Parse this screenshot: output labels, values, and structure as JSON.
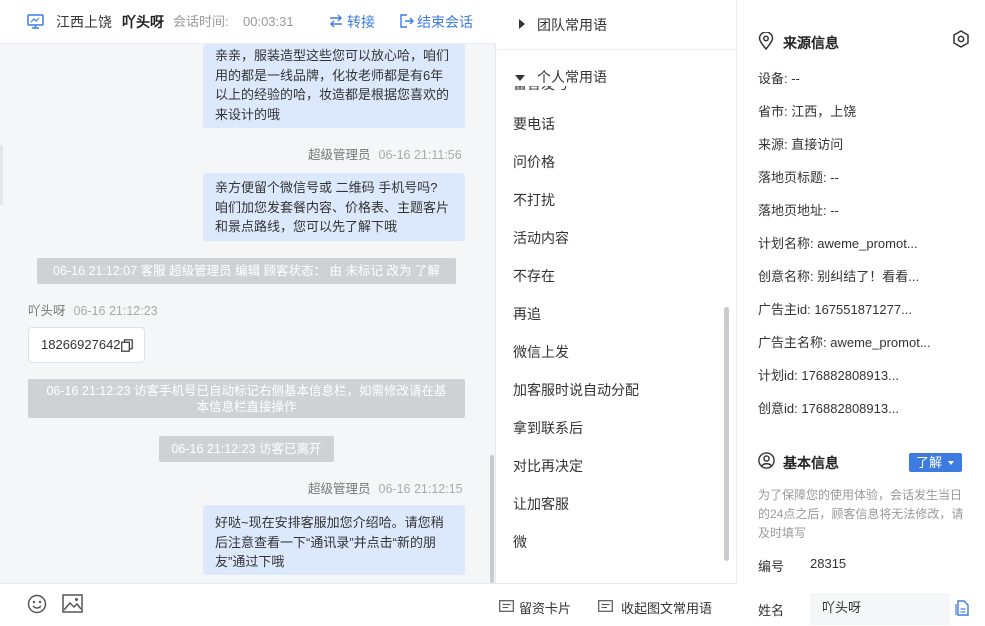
{
  "colors": {
    "accent": "#3d7be0",
    "bubble": "#dce9fd",
    "system_note": "#cfd1d5"
  },
  "header": {
    "region": "江西上饶",
    "visitor_name": "吖头呀",
    "time_label": "会话时间:",
    "time_value": "00:03:31",
    "transfer_label": "转接",
    "end_label": "结束会话"
  },
  "messages": {
    "bubble1": [
      "亲亲，服装造型这些您可以放心哈，咱们",
      "用的都是一线品牌，化妆老师都是有6年",
      "以上的经验的哈，妆造都是根据您喜欢的",
      "来设计的哦"
    ],
    "meta2": {
      "sender": "超级管理员",
      "time": "06-16 21:11:56"
    },
    "bubble2": [
      "亲方便留个微信号或 二维码 手机号吗?",
      "咱们加您发套餐内容、价格表、主题客片",
      "和景点路线，您可以先了解下哦"
    ],
    "sys1": "06-16 21:12:07 客服 超级管理员 编辑 顾客状态： 由 未标记 改为 了解",
    "meta3": {
      "sender": "吖头呀",
      "time": "06-16 21:12:23"
    },
    "phone": "18266927642",
    "sys2": [
      "06-16 21:12:23 访客手机号已自动标记右侧基本信息栏，如需修改请在基",
      "本信息栏直接操作"
    ],
    "sys3": "06-16 21:12:23 访客已离开",
    "meta4": {
      "sender": "超级管理员",
      "time": "06-16 21:12:15"
    },
    "bubble3": [
      "好哒~现在安排客服加您介绍哈。请您稍",
      "后注意查看一下“通讯录”并点击“新的朋",
      "友”通过下哦"
    ]
  },
  "footer_icons": {
    "emoji": "emoji-icon",
    "image": "image-icon"
  },
  "phrases": {
    "team_group": "团队常用语",
    "personal_group": "个人常用语",
    "clipped_item": "留言发号",
    "items": [
      "要电话",
      "问价格",
      "不打扰",
      "活动内容",
      "不存在",
      "再追",
      "微信上发",
      "加客服时说自动分配",
      "拿到联系后",
      "对比再决定",
      "让加客服",
      "微"
    ],
    "footer_card": "留资卡片",
    "footer_collapse": "收起图文常用语"
  },
  "source": {
    "title": "来源信息",
    "rows": [
      "设备: --",
      "省市: 江西，上饶",
      "来源: 直接访问",
      "落地页标题: --",
      "落地页地址: --",
      "计划名称: aweme_promot...",
      "创意名称: 别纠结了！看看...",
      "广告主id: 167551871277...",
      "广告主名称: aweme_promot...",
      "计划id: 176882808913...",
      "创意id: 176882808913..."
    ]
  },
  "basic": {
    "title": "基本信息",
    "status": "了解",
    "note": "为了保障您的使用体验，会话发生当日的24点之后，顾客信息将无法修改，请及时填写",
    "id_label": "编号",
    "id_value": "28315",
    "name_label": "姓名",
    "name_value": "吖头呀"
  }
}
